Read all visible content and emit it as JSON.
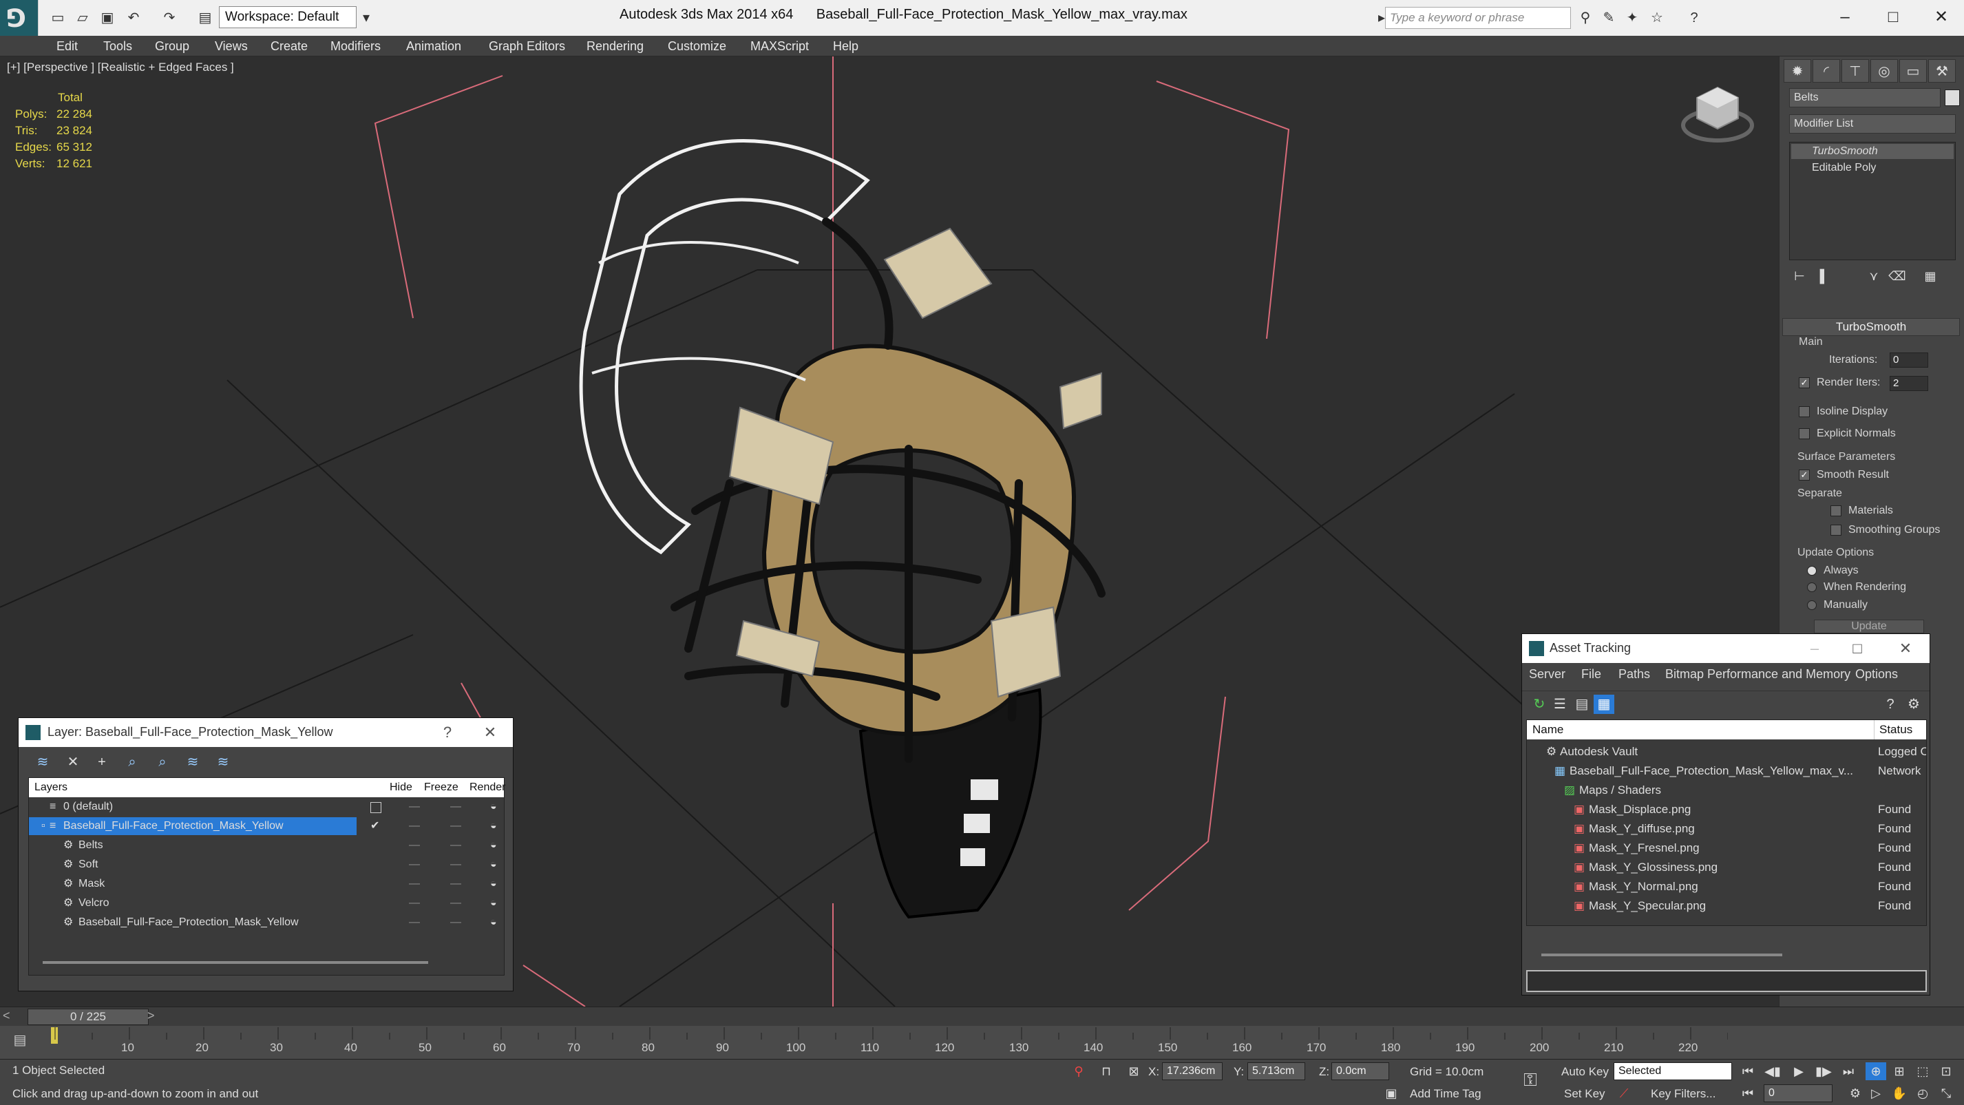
{
  "titlebar": {
    "workspace": "Workspace: Default",
    "app_name": "Autodesk 3ds Max  2014 x64",
    "file_name": "Baseball_Full-Face_Protection_Mask_Yellow_max_vray.max",
    "search_placeholder": "Type a keyword or phrase"
  },
  "menu": [
    "Edit",
    "Tools",
    "Group",
    "Views",
    "Create",
    "Modifiers",
    "Animation",
    "Graph Editors",
    "Rendering",
    "Customize",
    "MAXScript",
    "Help"
  ],
  "viewport": {
    "label": "[+] [Perspective ] [Realistic + Edged Faces ]",
    "stats_header": "Total",
    "stats": [
      {
        "label": "Polys:",
        "value": "22 284"
      },
      {
        "label": "Tris:",
        "value": "23 824"
      },
      {
        "label": "Edges:",
        "value": "65 312"
      },
      {
        "label": "Verts:",
        "value": "12 621"
      }
    ]
  },
  "command_panel": {
    "object_name": "Belts",
    "modifier_list": "Modifier List",
    "stack": [
      "TurboSmooth",
      "Editable Poly"
    ],
    "rollout_title": "TurboSmooth",
    "main_group": "Main",
    "iterations_label": "Iterations:",
    "iterations_value": "0",
    "render_iters_label": "Render Iters:",
    "render_iters_value": "2",
    "isoline": "Isoline Display",
    "explicit_normals": "Explicit Normals",
    "surface_group": "Surface Parameters",
    "smooth_result": "Smooth Result",
    "separate_label": "Separate",
    "materials": "Materials",
    "smoothing_groups": "Smoothing Groups",
    "update_group": "Update Options",
    "always": "Always",
    "when_rendering": "When Rendering",
    "manually": "Manually",
    "update_button": "Update"
  },
  "layer_dialog": {
    "title": "Layer: Baseball_Full-Face_Protection_Mask_Yellow",
    "help": "?",
    "columns": {
      "layers": "Layers",
      "hide": "Hide",
      "freeze": "Freeze",
      "render": "Render"
    },
    "rows": [
      {
        "name": "0 (default)"
      },
      {
        "name": "Baseball_Full-Face_Protection_Mask_Yellow"
      },
      {
        "name": "Belts"
      },
      {
        "name": "Soft"
      },
      {
        "name": "Mask"
      },
      {
        "name": "Velcro"
      },
      {
        "name": "Baseball_Full-Face_Protection_Mask_Yellow"
      }
    ]
  },
  "asset_dialog": {
    "title": "Asset Tracking",
    "menu": [
      "Server",
      "File",
      "Paths",
      "Bitmap Performance and Memory",
      "Options"
    ],
    "columns": {
      "name": "Name",
      "status": "Status"
    },
    "rows": [
      {
        "name": "Autodesk Vault",
        "status": "Logged C"
      },
      {
        "name": "Baseball_Full-Face_Protection_Mask_Yellow_max_v...",
        "status": "Network"
      },
      {
        "name": "Maps / Shaders",
        "status": ""
      },
      {
        "name": "Mask_Displace.png",
        "status": "Found"
      },
      {
        "name": "Mask_Y_diffuse.png",
        "status": "Found"
      },
      {
        "name": "Mask_Y_Fresnel.png",
        "status": "Found"
      },
      {
        "name": "Mask_Y_Glossiness.png",
        "status": "Found"
      },
      {
        "name": "Mask_Y_Normal.png",
        "status": "Found"
      },
      {
        "name": "Mask_Y_Specular.png",
        "status": "Found"
      }
    ]
  },
  "timeline": {
    "frame_counter": "0 / 225",
    "ticks": [
      "10",
      "20",
      "30",
      "40",
      "50",
      "60",
      "70",
      "80",
      "90",
      "100",
      "110",
      "120",
      "130",
      "140",
      "150",
      "160",
      "170",
      "180",
      "190",
      "200",
      "210",
      "220"
    ]
  },
  "status": {
    "selection": "1 Object Selected",
    "prompt": "Click and drag up-and-down to zoom in and out",
    "x_label": "X:",
    "x_value": "17.236cm",
    "y_label": "Y:",
    "y_value": "5.713cm",
    "z_label": "Z:",
    "z_value": "0.0cm",
    "grid": "Grid = 10.0cm",
    "auto_key": "Auto Key",
    "selected": "Selected",
    "set_key": "Set Key",
    "key_filters": "Key Filters...",
    "add_time_tag": "Add Time Tag",
    "frame": "0"
  }
}
